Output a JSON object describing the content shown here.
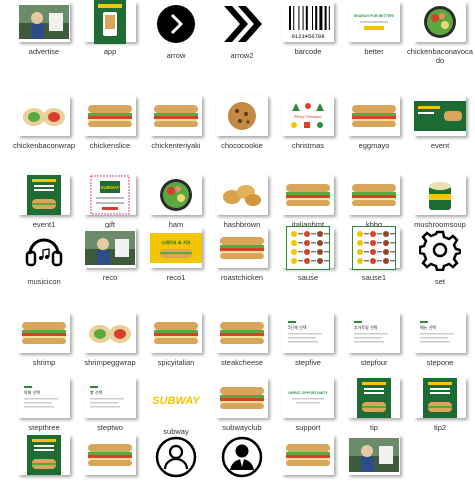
{
  "colors": {
    "subway_green": "#1e6b34",
    "subway_yellow": "#f3c600",
    "bread": "#d9a55a",
    "lettuce": "#5aa83e",
    "tomato": "#d8402c",
    "ham": "#e58a7a",
    "cookie": "#c48a45"
  },
  "files": [
    {
      "name": "advertise",
      "icon": "photo-thumb"
    },
    {
      "name": "app",
      "icon": "app-banner-thumb"
    },
    {
      "name": "arrow",
      "icon": "arrow-circle-icon"
    },
    {
      "name": "arrow2",
      "icon": "double-chevron-icon"
    },
    {
      "name": "barcode",
      "icon": "barcode-icon",
      "text": "0123456789"
    },
    {
      "name": "better",
      "icon": "banner-thumb",
      "text": "SEARCH FOR BETTER!"
    },
    {
      "name": "chickenbaconavocado",
      "icon": "salad-bowl-thumb"
    },
    {
      "name": "chickenbaconwrap",
      "icon": "wrap-thumb"
    },
    {
      "name": "chickenslice",
      "icon": "sandwich-thumb"
    },
    {
      "name": "chickenteriyaki",
      "icon": "sandwich-thumb"
    },
    {
      "name": "chococookie",
      "icon": "cookie-thumb"
    },
    {
      "name": "christmas",
      "icon": "christmas-thumb",
      "text": "Merry Christmas"
    },
    {
      "name": "eggmayo",
      "icon": "sandwich-thumb"
    },
    {
      "name": "event",
      "icon": "green-banner-thumb"
    },
    {
      "name": "event1",
      "icon": "green-poster-thumb"
    },
    {
      "name": "gift",
      "icon": "gift-card-thumb",
      "text": "SUBWAY"
    },
    {
      "name": "ham",
      "icon": "salad-bowl-thumb"
    },
    {
      "name": "hashbrown",
      "icon": "hashbrown-thumb"
    },
    {
      "name": "italianbmt",
      "icon": "sandwich-thumb"
    },
    {
      "name": "kbbq",
      "icon": "sandwich-thumb"
    },
    {
      "name": "mushroomsoup",
      "icon": "soup-cup-thumb"
    },
    {
      "name": "musicicon",
      "icon": "headphones-icon"
    },
    {
      "name": "reco",
      "icon": "photo-thumb"
    },
    {
      "name": "reco1",
      "icon": "yellow-banner-thumb",
      "text": "스테이크 & 치즈"
    },
    {
      "name": "roastchicken",
      "icon": "sandwich-thumb"
    },
    {
      "name": "sause",
      "icon": "sauce-menu-thumb"
    },
    {
      "name": "sause1",
      "icon": "sauce-menu-thumb"
    },
    {
      "name": "set",
      "icon": "gear-icon"
    },
    {
      "name": "shrimp",
      "icon": "sandwich-thumb"
    },
    {
      "name": "shrimpeggwrap",
      "icon": "wrap-thumb"
    },
    {
      "name": "spicyitalian",
      "icon": "sandwich-thumb"
    },
    {
      "name": "steakcheese",
      "icon": "sandwich-thumb"
    },
    {
      "name": "stepfive",
      "icon": "step-doc-thumb",
      "text": "5단계 선택"
    },
    {
      "name": "stepfour",
      "icon": "step-doc-thumb",
      "text": "추가토핑 선택"
    },
    {
      "name": "stepone",
      "icon": "step-doc-thumb",
      "text": "메뉴 선택"
    },
    {
      "name": "stepthree",
      "icon": "step-doc-thumb",
      "text": "야채 선택"
    },
    {
      "name": "steptwo",
      "icon": "step-doc-thumb",
      "text": "빵 선택"
    },
    {
      "name": "subway",
      "icon": "subway-logo-thumb",
      "text": "SUBWAY"
    },
    {
      "name": "subwayclub",
      "icon": "sandwich-thumb"
    },
    {
      "name": "support",
      "icon": "support-banner-thumb",
      "text": "GREAT OPPORTUNITY"
    },
    {
      "name": "tip",
      "icon": "green-poster-thumb"
    },
    {
      "name": "tip2",
      "icon": "green-poster-thumb"
    },
    {
      "name": "",
      "icon": "green-poster-thumb"
    },
    {
      "name": "",
      "icon": "sandwich-thumb"
    },
    {
      "name": "",
      "icon": "user-circle-icon"
    },
    {
      "name": "",
      "icon": "user-suit-icon"
    },
    {
      "name": "",
      "icon": "sandwich-thumb"
    },
    {
      "name": "",
      "icon": "photo-thumb"
    }
  ]
}
